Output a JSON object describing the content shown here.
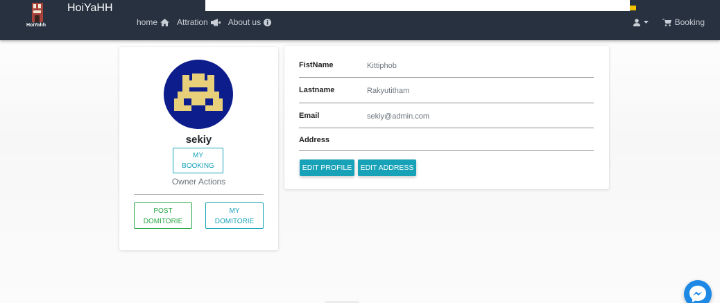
{
  "navbar": {
    "brand": "HoiYaHH",
    "logo_caption": "HoiYahh",
    "links": {
      "home": "home",
      "attraction": "Attration",
      "about": "About us"
    },
    "booking": "Booking"
  },
  "profile": {
    "username": "sekiy",
    "my_booking_line1": "MY",
    "my_booking_line2": "BOOKING",
    "owner_actions": "Owner Actions",
    "post_line1": "POST",
    "post_line2": "DOMITORIE",
    "mydorm_line1": "MY",
    "mydorm_line2": "DOMITORIE"
  },
  "info": {
    "first_name_label": "FistName",
    "first_name": "Kittiphob",
    "last_name_label": "Lastname",
    "last_name": "Rakyutitham",
    "email_label": "Email",
    "email": "sekiy@admin.com",
    "address_label": "Address",
    "address": "",
    "edit_profile": "EDIT PROFILE",
    "edit_address": "EDIT ADDRESS"
  },
  "colors": {
    "navbar": "#27313f",
    "info": "#17a2b8",
    "success": "#28a745",
    "avatar_bg": "#0d1d8c",
    "avatar_fg": "#e8cf7a",
    "messenger": "#1e88e5"
  },
  "icons": [
    "home-icon",
    "bullhorn-icon",
    "info-circle-icon",
    "user-icon",
    "caret-down-icon",
    "cart-icon",
    "messenger-icon"
  ]
}
